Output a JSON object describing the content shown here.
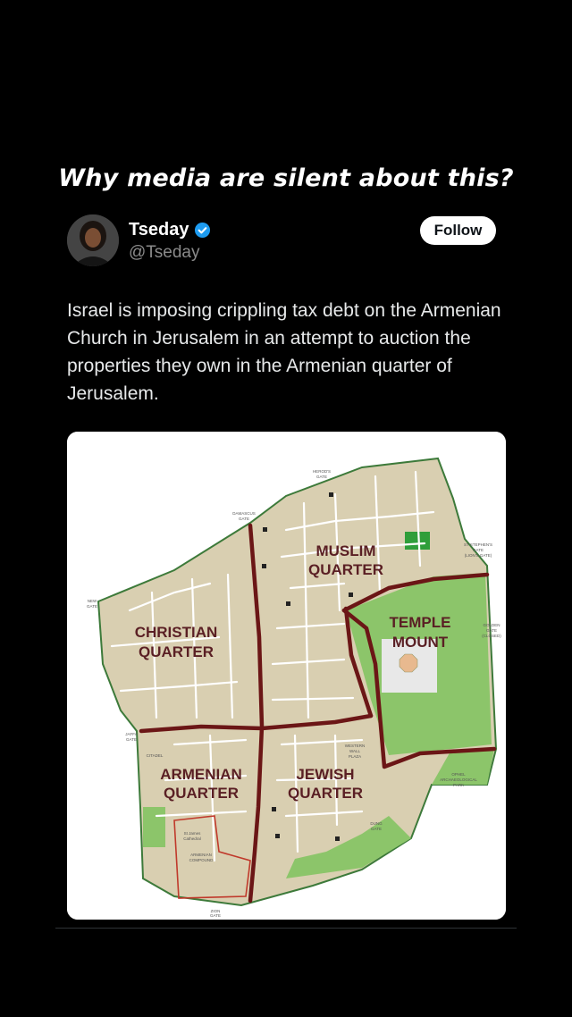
{
  "headline": "Why media are silent about this?",
  "post": {
    "author_name": "Tseday",
    "author_handle": "@Tseday",
    "verified": true,
    "follow_label": "Follow",
    "text": "Israel is imposing crippling tax debt on the Armenian Church in Jerusalem in an attempt to auction the properties they own in the Armenian quarter of Jerusalem."
  },
  "map": {
    "quarters": {
      "muslim": [
        "MUSLIM",
        "QUARTER"
      ],
      "christian": [
        "CHRISTIAN",
        "QUARTER"
      ],
      "temple": [
        "TEMPLE",
        "MOUNT"
      ],
      "armenian": [
        "ARMENIAN",
        "QUARTER"
      ],
      "jewish": [
        "JEWISH",
        "QUARTER"
      ]
    },
    "gates": {
      "herods": [
        "HEROD'S",
        "GATE"
      ],
      "damascus": [
        "DAMASCUS",
        "GATE"
      ],
      "st_stephens": [
        "ST STEPHEN'S",
        "GATE",
        "(LION'S GATE)"
      ],
      "new": [
        "NEW",
        "GATE"
      ],
      "golden": [
        "GOLDEN",
        "GATE",
        "(CLOSED)"
      ],
      "jaffa": [
        "JAFFA",
        "GATE"
      ],
      "dung": [
        "DUNG",
        "GATE"
      ],
      "zion": [
        "ZION",
        "GATE"
      ]
    },
    "other_labels": {
      "western_wall": [
        "WESTERN",
        "WALL",
        "PLAZA"
      ],
      "ophel": [
        "OPHEL",
        "ARCHAEOLOGICAL",
        "PARK"
      ],
      "citadel": "CITADEL",
      "st_james": [
        "St James",
        "Cathedral"
      ],
      "armenian_compound": [
        "ARMENIAN",
        "COMPOUND"
      ]
    },
    "colors": {
      "city_fill": "#d9cfb1",
      "road_line": "#ffffff",
      "quarter_border": "#6b1616",
      "park_green": "#8cc56a",
      "wall_green": "#3d7a3a"
    }
  }
}
